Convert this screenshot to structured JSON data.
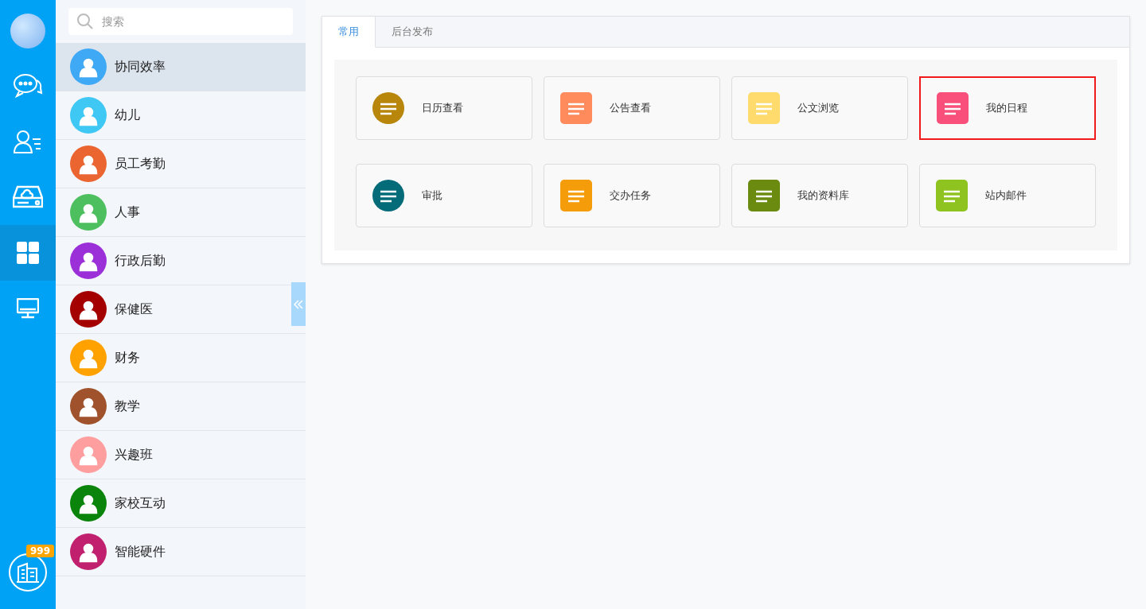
{
  "rail": {
    "items": [
      {
        "selected": false
      },
      {
        "selected": false
      },
      {
        "selected": false
      },
      {
        "selected": true
      },
      {
        "selected": false
      }
    ],
    "badge": "999"
  },
  "sidebar": {
    "search": {
      "placeholder": "搜索"
    },
    "items": [
      {
        "label": "协同效率",
        "color": "#3fa9f5",
        "selected": true
      },
      {
        "label": "幼儿",
        "color": "#3fc8f4",
        "selected": false
      },
      {
        "label": "员工考勤",
        "color": "#ea6530",
        "selected": false
      },
      {
        "label": "人事",
        "color": "#4dbf5e",
        "selected": false
      },
      {
        "label": "行政后勤",
        "color": "#9b30d9",
        "selected": false
      },
      {
        "label": "保健医",
        "color": "#a50000",
        "selected": false
      },
      {
        "label": "财务",
        "color": "#ffa200",
        "selected": false
      },
      {
        "label": "教学",
        "color": "#a0522d",
        "selected": false
      },
      {
        "label": "兴趣班",
        "color": "#ff9e9e",
        "selected": false
      },
      {
        "label": "家校互动",
        "color": "#0a840a",
        "selected": false
      },
      {
        "label": "智能硬件",
        "color": "#c0206e",
        "selected": false
      }
    ]
  },
  "tabs": [
    {
      "label": "常用",
      "selected": true
    },
    {
      "label": "后台发布",
      "selected": false
    }
  ],
  "cards": [
    {
      "label": "日历查看",
      "color": "#b8860b",
      "selected": false
    },
    {
      "label": "公告查看",
      "color": "#ff8a5c",
      "selected": false
    },
    {
      "label": "公文浏览",
      "color": "#ffdb6e",
      "selected": false
    },
    {
      "label": "我的日程",
      "color": "#f8507a",
      "selected": true
    },
    {
      "label": "审批",
      "color": "#046b78",
      "selected": false
    },
    {
      "label": "交办任务",
      "color": "#f59c0a",
      "selected": false
    },
    {
      "label": "我的资料库",
      "color": "#6a8a10",
      "selected": false
    },
    {
      "label": "站内邮件",
      "color": "#8fc31f",
      "selected": false
    }
  ]
}
